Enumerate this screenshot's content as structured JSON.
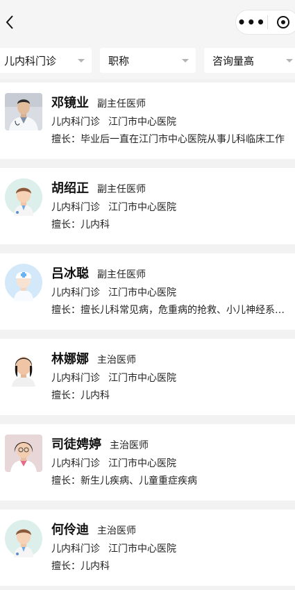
{
  "navbar": {
    "back_icon": "chevron-left-icon",
    "more_icon": "more-dots-icon",
    "more_glyph": "•••",
    "close_icon": "target-icon"
  },
  "filters": [
    {
      "label": "儿内科门诊"
    },
    {
      "label": "职称"
    },
    {
      "label": "咨询量高"
    }
  ],
  "specialty_prefix": "擅长：",
  "doctors": [
    {
      "name": "邓镜业",
      "title": "副主任医师",
      "dept": "儿内科门诊",
      "hospital": "江门市中心医院",
      "specialty": "擅长：毕业后一直在江门市中心医院从事儿科临床工作"
    },
    {
      "name": "胡绍正",
      "title": "副主任医师",
      "dept": "儿内科门诊",
      "hospital": "江门市中心医院",
      "specialty": "擅长：儿内科"
    },
    {
      "name": "吕冰聪",
      "title": "副主任医师",
      "dept": "儿内科门诊",
      "hospital": "江门市中心医院",
      "specialty": "擅长：擅长儿科常见病，危重病的抢救、小儿神经系统疾病"
    },
    {
      "name": "林娜娜",
      "title": "主治医师",
      "dept": "儿内科门诊",
      "hospital": "江门市中心医院",
      "specialty": "擅长：儿内科"
    },
    {
      "name": "司徒娉婷",
      "title": "主治医师",
      "dept": "儿内科门诊",
      "hospital": "江门市中心医院",
      "specialty": "擅长：新生儿疾病、儿童重症疾病"
    },
    {
      "name": "何伶迪",
      "title": "主治医师",
      "dept": "儿内科门诊",
      "hospital": "江门市中心医院",
      "specialty": "擅长：儿内科"
    }
  ]
}
